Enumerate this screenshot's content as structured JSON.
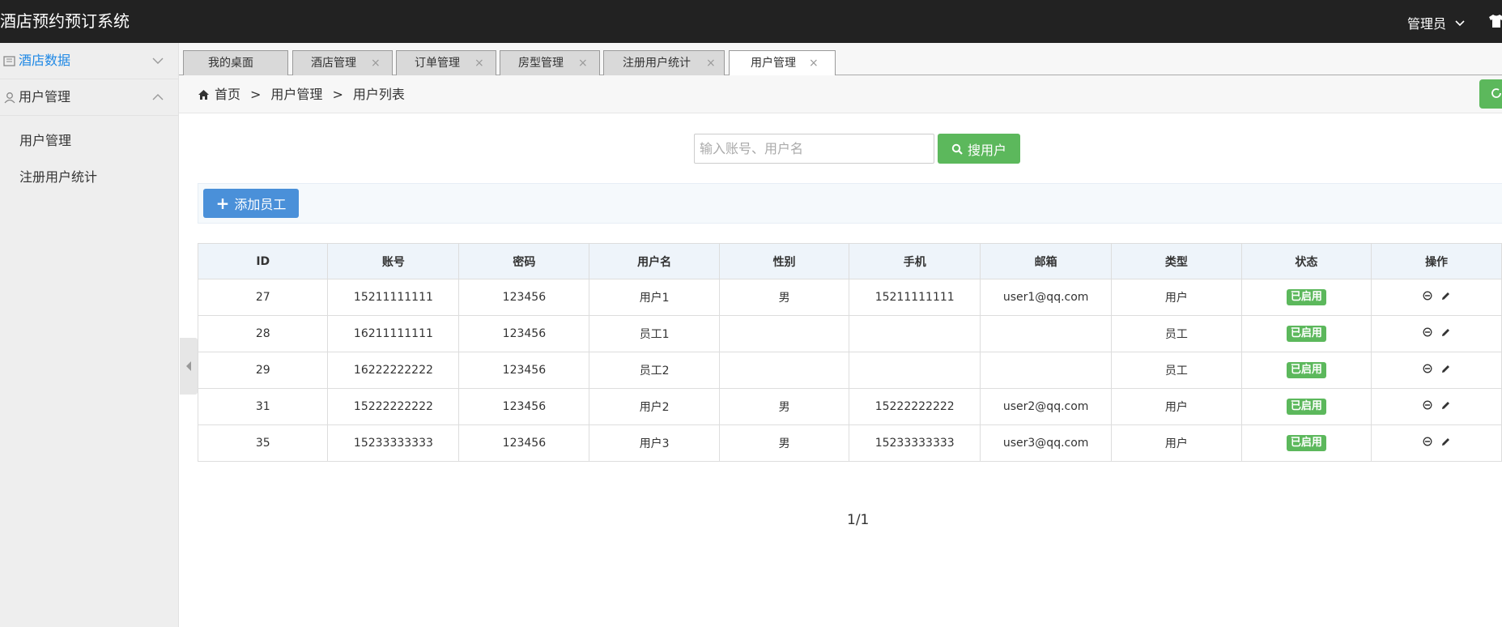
{
  "header": {
    "title": "酒店预约预订系统",
    "user": "管理员"
  },
  "sidebar": {
    "groups": [
      {
        "label": "酒店数据",
        "color": "#1e88e5"
      },
      {
        "label": "用户管理"
      }
    ],
    "sub_items": [
      "用户管理",
      "注册用户统计"
    ]
  },
  "tabs": [
    {
      "label": "我的桌面"
    },
    {
      "label": "酒店管理"
    },
    {
      "label": "订单管理"
    },
    {
      "label": "房型管理"
    },
    {
      "label": "注册用户统计"
    },
    {
      "label": "用户管理"
    }
  ],
  "tab_close": "×",
  "breadcrumb": {
    "home": "首页",
    "sep": ">",
    "level1": "用户管理",
    "level2": "用户列表"
  },
  "search": {
    "placeholder": "输入账号、用户名",
    "button": "搜用户"
  },
  "toolbar": {
    "add_label": "添加员工"
  },
  "table": {
    "headers": [
      "ID",
      "账号",
      "密码",
      "用户名",
      "性别",
      "手机",
      "邮箱",
      "类型",
      "状态",
      "操作"
    ],
    "rows": [
      [
        "27",
        "15211111111",
        "123456",
        "用户1",
        "男",
        "15211111111",
        "user1@qq.com",
        "用户",
        "已启用"
      ],
      [
        "28",
        "16211111111",
        "123456",
        "员工1",
        "",
        "",
        "",
        "员工",
        "已启用"
      ],
      [
        "29",
        "16222222222",
        "123456",
        "员工2",
        "",
        "",
        "",
        "员工",
        "已启用"
      ],
      [
        "31",
        "15222222222",
        "123456",
        "用户2",
        "男",
        "15222222222",
        "user2@qq.com",
        "用户",
        "已启用"
      ],
      [
        "35",
        "15233333333",
        "123456",
        "用户3",
        "男",
        "15233333333",
        "user3@qq.com",
        "用户",
        "已启用"
      ]
    ]
  },
  "pager": "1/1",
  "colors": {
    "primary_green": "#5cb85c",
    "primary_blue": "#4a90d9",
    "header_bg": "#222222"
  }
}
